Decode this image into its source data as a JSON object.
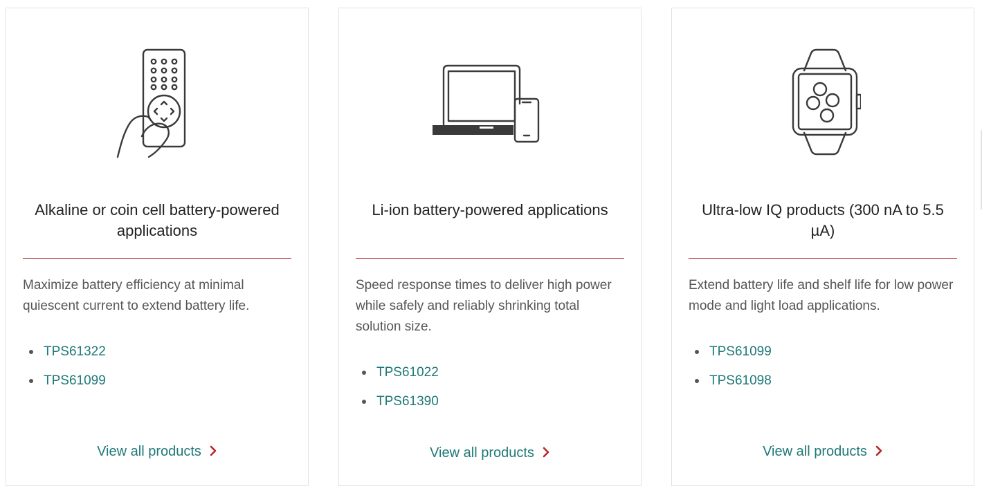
{
  "cards": [
    {
      "icon": "remote-control-hand-icon",
      "title": "Alkaline or coin cell battery-powered applications",
      "description": "Maximize battery efficiency at minimal quiescent current to extend battery life.",
      "products": [
        "TPS61322",
        "TPS61099"
      ],
      "view_all": "View all products"
    },
    {
      "icon": "laptop-phone-icon",
      "title": "Li-ion battery-powered applications",
      "description": "Speed response times to deliver high power while safely and reliably shrinking total solution size.",
      "products": [
        "TPS61022",
        "TPS61390"
      ],
      "view_all": "View all products"
    },
    {
      "icon": "smartwatch-icon",
      "title": "Ultra-low IQ products (300 nA to 5.5 µA)",
      "description": "Extend battery life and shelf life for low power mode and light load applications.",
      "products": [
        "TPS61099",
        "TPS61098"
      ],
      "view_all": "View all products"
    }
  ],
  "colors": {
    "accent_red": "#b5262b",
    "link_teal": "#1f7878",
    "icon_gray": "#3a3a3a"
  }
}
